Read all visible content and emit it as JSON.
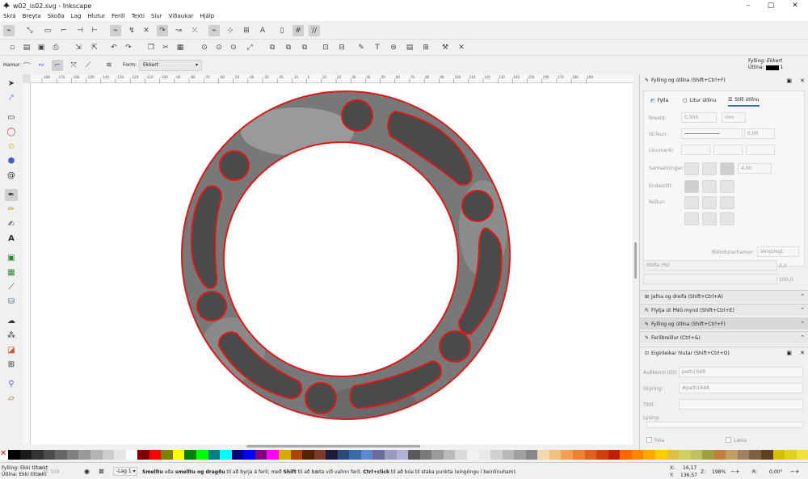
{
  "window": {
    "title": "w02_is02.svg - Inkscape",
    "min": "–",
    "max": "▢",
    "close": "✕"
  },
  "menu": [
    "Skrá",
    "Breyta",
    "Skoða",
    "Lag",
    "Hlutur",
    "Ferill",
    "Texti",
    "Síur",
    "Viðaukar",
    "Hjálp"
  ],
  "ctrl": {
    "mode_label": "Hamur:",
    "shape_label": "Form:",
    "shape_value": "Ekkert"
  },
  "style_indicator": {
    "fill_label": "Fylling:",
    "fill_value": "Ekkert",
    "stroke_label": "Útlína:",
    "stroke_width": "1"
  },
  "ruler_ticks": [
    "-180",
    "-170",
    "-160",
    "-150",
    "-140",
    "-130",
    "-120",
    "-110",
    "-100",
    "-90",
    "-80",
    "-70",
    "-60",
    "-50",
    "-40",
    "-30",
    "-20",
    "-10",
    "0",
    "10",
    "20",
    "30",
    "40",
    "50",
    "60",
    "70",
    "80",
    "90",
    "100",
    "110",
    "120",
    "130",
    "140",
    "150",
    "160",
    "170",
    "180",
    "190"
  ],
  "fill_panel": {
    "header": "Fylling og útlína (Shift+Ctrl+F)",
    "tabs": [
      "Fylla",
      "Litur útlínu",
      "Stíll útlínu"
    ],
    "width_label": "Breidd:",
    "width_value": "0,500",
    "unit": "mm",
    "dash_label": "Strikun:",
    "dash_value": "0,00",
    "markers_label": "Línumerki:",
    "join_label": "Samsetningar:",
    "join_value": "4,00",
    "cap_label": "Endastílll:",
    "order_label": "Röðun:",
    "blend_label": "Blöndunarhamur:",
    "blend_value": "Venjulegt",
    "blur_label": "Móða (%)",
    "blur_value": "0,0",
    "opacity_value": "100,0"
  },
  "docked": [
    "Jafna og dreifa (Shift+Ctrl+A)",
    "Flytja út PNG mynd (Shift+Ctrl+E)",
    "Fylling og útlína (Shift+Ctrl+F)",
    "Ferilbreillur (Ctrl+&)"
  ],
  "objprops": {
    "header": "Eiginleikar hlutar (Shift+Ctrl+O)",
    "id_label": "Auðkenni (ID):",
    "id_value": "path1648",
    "label_label": "Skýring:",
    "label_value": "#path1648",
    "title_label": "Titill:",
    "desc_label": "Lýsing:",
    "hide_label": "Fela",
    "lock_label": "Læsa"
  },
  "status": {
    "fill_label": "Fylling:",
    "fill_value": "Ekki tiltækt",
    "stroke_label": "Útlína:",
    "stroke_value": "Ekki tiltækt",
    "opacity_label": "O:",
    "opacity_value": "100",
    "layer": "-Lag 1",
    "msg_bold1": "Smelltu",
    "msg_1": " eða ",
    "msg_bold2": "smelltu og dragðu",
    "msg_2": " til að byrja á ferli; með ",
    "msg_bold3": "Shift",
    "msg_3": " til að bæta við valinn feril. ",
    "msg_bold4": "Ctrl+click",
    "msg_4": " til að búa til staka punkta (eingöngu í beinlínuham).",
    "x_label": "X:",
    "x_value": "16,17",
    "y_label": "Y:",
    "y_value": "136,57",
    "z_label": "Z:",
    "zoom": "198%",
    "r_label": "R:",
    "rotation": "0,00°"
  },
  "palette": [
    "#000000",
    "#1a1a1a",
    "#333333",
    "#4d4d4d",
    "#666666",
    "#808080",
    "#999999",
    "#b3b3b3",
    "#cccccc",
    "#e6e6e6",
    "#ffffff",
    "#800000",
    "#ff0000",
    "#808000",
    "#ffff00",
    "#008000",
    "#00ff00",
    "#008080",
    "#00ffff",
    "#000080",
    "#0000ff",
    "#800080",
    "#ff00ff",
    "#d4aa00",
    "#aa4400",
    "#552200",
    "#7b3a2a",
    "#1b1b3a",
    "#2a4a7a",
    "#3a6aa8",
    "#5a8ad0",
    "#6c6c9a",
    "#9a9ac0",
    "#b0b0d8",
    "#5a5a5a",
    "#7a7a7a",
    "#9a9a9a",
    "#bababa",
    "#dadada",
    "#f2f2f2",
    "#e8e8e8",
    "#d0d0d0",
    "#b8b8b8",
    "#a0a0a0",
    "#888888",
    "#f2d7b0",
    "#f0c080",
    "#f0a050",
    "#ee8030",
    "#e06020",
    "#d04010",
    "#c02000",
    "#ff6600",
    "#ff8800",
    "#ffaa00",
    "#ffcc00",
    "#e0c040",
    "#d0d060",
    "#c0c060",
    "#a0a040",
    "#c08040",
    "#c0a060",
    "#a08060",
    "#806040",
    "#604020",
    "#d4c000",
    "#e0d020",
    "#f0e040"
  ]
}
